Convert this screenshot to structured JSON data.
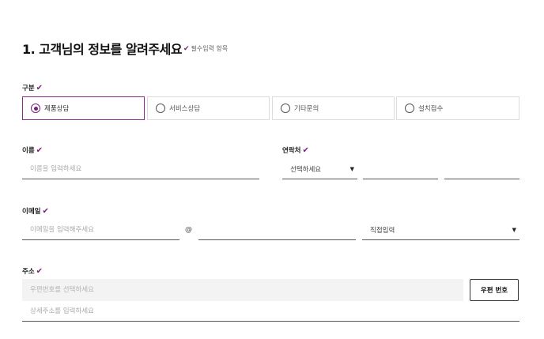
{
  "section": {
    "title": "1. 고객님의 정보를 알려주세요",
    "required_mark": "✔",
    "required_note": "필수입력 항목"
  },
  "category": {
    "label": "구분",
    "options": [
      {
        "label": "제품상담",
        "selected": true
      },
      {
        "label": "서비스상담",
        "selected": false
      },
      {
        "label": "기타문의",
        "selected": false
      },
      {
        "label": "설치접수",
        "selected": false
      }
    ]
  },
  "name": {
    "label": "이름",
    "placeholder": "이름을 입력하세요"
  },
  "contact": {
    "label": "연락처",
    "select_value": "선택하세요",
    "middle_value": "",
    "last_value": ""
  },
  "email": {
    "label": "이메일",
    "placeholder": "이메일을 입력해주세요",
    "at_symbol": "@",
    "domain_value": "",
    "domain_select": "직접입력"
  },
  "address": {
    "label": "주소",
    "zip_placeholder": "우편번호를 선택하세요",
    "zip_button": "우편 번호",
    "detail_placeholder": "상세주소를 입력하세요"
  },
  "colors": {
    "accent": "#7a1f7a"
  }
}
